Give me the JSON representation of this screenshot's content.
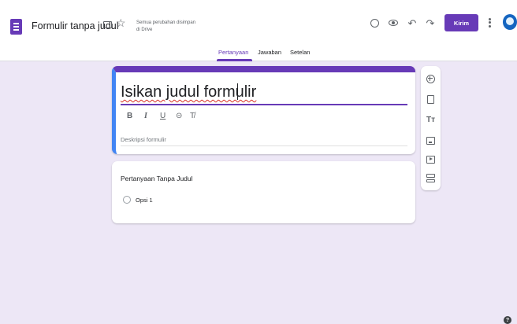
{
  "header": {
    "doc_title": "Formulir tanpa judul",
    "save_status_line1": "Semua perubahan disimpan",
    "save_status_line2": "di Drive",
    "send_label": "Kirim",
    "icons": [
      "forms-logo-icon",
      "folder-icon",
      "star-icon",
      "palette-icon",
      "eye-icon",
      "undo-icon",
      "redo-icon",
      "more-vert-icon",
      "avatar"
    ]
  },
  "tabs": [
    {
      "label": "Pertanyaan",
      "active": true
    },
    {
      "label": "Jawaban",
      "active": false
    },
    {
      "label": "Setelan",
      "active": false
    }
  ],
  "form": {
    "title": "Isikan judul formulir",
    "description_placeholder": "Deskripsi formulir",
    "format_buttons": [
      "B",
      "I",
      "U",
      "⊝",
      "T̸"
    ]
  },
  "question": {
    "title": "Pertanyaan Tanpa Judul",
    "option_1": "Opsi 1"
  },
  "side_toolbar": {
    "icons": [
      "add-question-icon",
      "import-question-icon",
      "add-title-icon",
      "add-image-icon",
      "add-video-icon",
      "add-section-icon"
    ],
    "title_text_glyph": "Tт"
  },
  "colors": {
    "accent": "#673ab7",
    "focus_border": "#4285f4",
    "background": "#ede7f6"
  },
  "help_glyph": "?"
}
